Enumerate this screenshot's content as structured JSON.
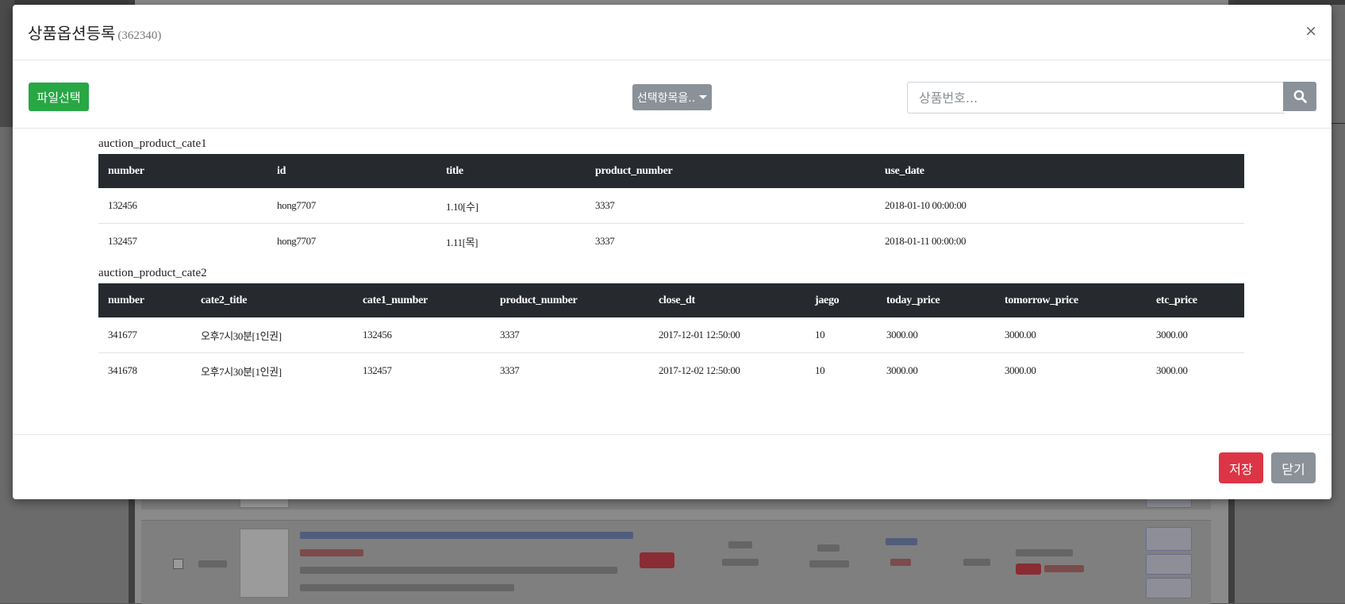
{
  "modal": {
    "title": "상품옵션등록",
    "subtitle": "(362340)",
    "close_glyph": "×"
  },
  "toolbar": {
    "file_button": "파일선택",
    "select_button": "선택항목을..",
    "search_placeholder": "상품번호...",
    "search_value": "",
    "search_icon": "search-icon"
  },
  "tables": {
    "cate1": {
      "caption": "auction_product_cate1",
      "columns": [
        "number",
        "id",
        "title",
        "product_number",
        "use_date"
      ],
      "rows": [
        [
          "132456",
          "hong7707",
          "1.10[수]",
          "3337",
          "2018-01-10 00:00:00"
        ],
        [
          "132457",
          "hong7707",
          "1.11[목]",
          "3337",
          "2018-01-11 00:00:00"
        ]
      ]
    },
    "cate2": {
      "caption": "auction_product_cate2",
      "columns": [
        "number",
        "cate2_title",
        "cate1_number",
        "product_number",
        "close_dt",
        "jaego",
        "today_price",
        "tomorrow_price",
        "etc_price"
      ],
      "rows": [
        [
          "341677",
          "오후7시30분[1인권]",
          "132456",
          "3337",
          "2017-12-01 12:50:00",
          "10",
          "3000.00",
          "3000.00",
          "3000.00"
        ],
        [
          "341678",
          "오후7시30분[1인권]",
          "132457",
          "3337",
          "2017-12-02 12:50:00",
          "10",
          "3000.00",
          "3000.00",
          "3000.00"
        ]
      ]
    }
  },
  "footer": {
    "save_button": "저장",
    "close_button": "닫기"
  },
  "colors": {
    "success": "#28a745",
    "danger": "#dc3545",
    "secondary": "#8a9199",
    "table_header": "#262a2e"
  }
}
